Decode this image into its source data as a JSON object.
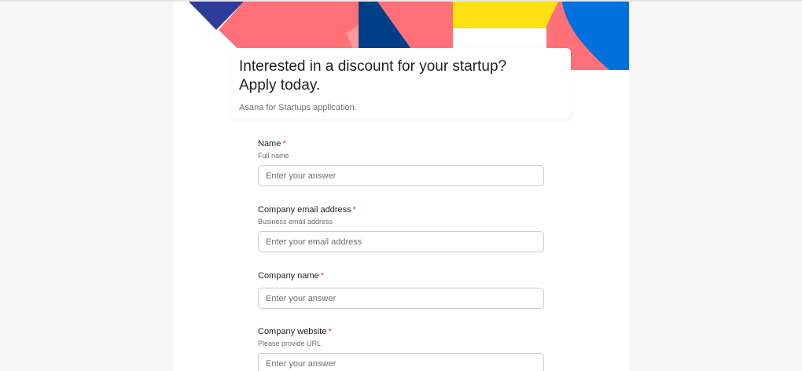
{
  "header": {
    "title": "Interested in a discount for your startup?\nApply today.",
    "subtitle": "Asana for Startups application."
  },
  "banner_colors": {
    "navy": "#2e3c99",
    "coral": "#ff7079",
    "pink": "#fc979a",
    "dark_blue": "#003f87",
    "yellow": "#ffe010",
    "blue": "#0070dd"
  },
  "fields": [
    {
      "label": "Name",
      "required_mark": "*",
      "help": "Full name",
      "placeholder": "Enter your answer"
    },
    {
      "label": "Company email address",
      "required_mark": "*",
      "help": "Business email address",
      "placeholder": "Enter your email address"
    },
    {
      "label": "Company name",
      "required_mark": "*",
      "placeholder": "Enter your answer"
    },
    {
      "label": "Company website",
      "required_mark": "*",
      "help": "Please provide URL",
      "placeholder": "Enter your answer"
    }
  ]
}
